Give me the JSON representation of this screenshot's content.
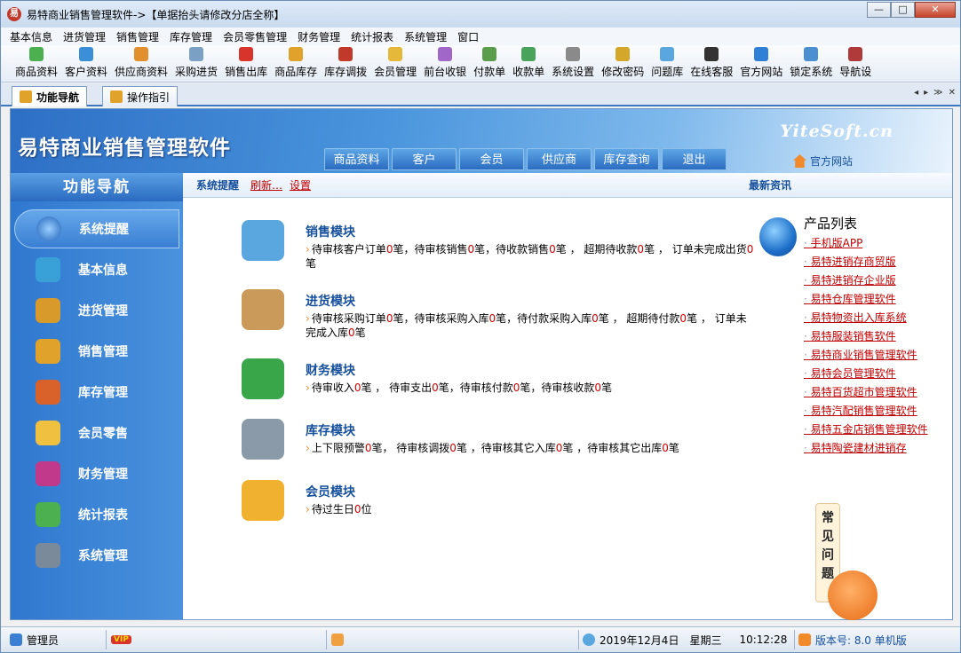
{
  "window": {
    "title": "易特商业销售管理软件->【单据抬头请修改分店全称】",
    "min": "—",
    "max": "□",
    "close": "✕"
  },
  "menu": [
    "基本信息",
    "进货管理",
    "销售管理",
    "库存管理",
    "会员零售管理",
    "财务管理",
    "统计报表",
    "系统管理",
    "窗口"
  ],
  "toolbar": [
    {
      "label": "商品资料",
      "color": "#4caf50"
    },
    {
      "label": "客户资料",
      "color": "#3a8fd6"
    },
    {
      "label": "供应商资料",
      "color": "#e2902d"
    },
    {
      "label": "采购进货",
      "color": "#7aa0c4"
    },
    {
      "label": "销售出库",
      "color": "#d9342b"
    },
    {
      "label": "商品库存",
      "color": "#e0a22a"
    },
    {
      "label": "库存调拨",
      "color": "#c0392b"
    },
    {
      "label": "会员管理",
      "color": "#e6b83a"
    },
    {
      "label": "前台收银",
      "color": "#a066c8"
    },
    {
      "label": "付款单",
      "color": "#5a9e4b"
    },
    {
      "label": "收款单",
      "color": "#4aa35a"
    },
    {
      "label": "系统设置",
      "color": "#8a8a8a"
    },
    {
      "label": "修改密码",
      "color": "#d4a62a"
    },
    {
      "label": "问题库",
      "color": "#5aa7e0"
    },
    {
      "label": "在线客服",
      "color": "#333333"
    },
    {
      "label": "官方网站",
      "color": "#2f7fd6"
    },
    {
      "label": "锁定系统",
      "color": "#4a90d0"
    },
    {
      "label": "导航设",
      "color": "#b03a3a"
    }
  ],
  "tabs": [
    {
      "label": "功能导航"
    },
    {
      "label": "操作指引"
    }
  ],
  "tab_controls": [
    "◂",
    "▸",
    "≫",
    "✕"
  ],
  "banner": {
    "title": "易特商业销售管理软件",
    "brand": "YiteSoft.cn",
    "official": "官方网站"
  },
  "topnav": [
    "商品资料",
    "客户",
    "会员",
    "供应商",
    "库存查询",
    "退出"
  ],
  "sidebar": {
    "head": "功能导航",
    "items": [
      {
        "label": "系统提醒",
        "color": "#1d5fb7"
      },
      {
        "label": "基本信息",
        "color": "#3aa0d8"
      },
      {
        "label": "进货管理",
        "color": "#d89a2a"
      },
      {
        "label": "销售管理",
        "color": "#e0a22a"
      },
      {
        "label": "库存管理",
        "color": "#d9622b"
      },
      {
        "label": "会员零售",
        "color": "#f0c040"
      },
      {
        "label": "财务管理",
        "color": "#c0398b"
      },
      {
        "label": "统计报表",
        "color": "#4caf50"
      },
      {
        "label": "系统管理",
        "color": "#7a8a9a"
      }
    ]
  },
  "content_header": {
    "title": "系统提醒",
    "refresh": "刷新…",
    "settings": "设置",
    "news": "最新资讯"
  },
  "modules": [
    {
      "title": "销售模块",
      "color": "#5aa7e0",
      "parts": [
        "待审核客户订单",
        "0",
        "笔，待审核销售",
        "0",
        "笔，待收款销售",
        "0",
        "笔 ， 超期待收款",
        "0",
        "笔 ， 订单未完成出货",
        "0",
        "笔"
      ]
    },
    {
      "title": "进货模块",
      "color": "#c99a5a",
      "parts": [
        "待审核采购订单",
        "0",
        "笔，待审核采购入库",
        "0",
        "笔，待付款采购入库",
        "0",
        "笔 ， 超期待付款",
        "0",
        "笔 ， 订单未完成入库",
        "0",
        "笔"
      ]
    },
    {
      "title": "财务模块",
      "color": "#3aa64a",
      "parts": [
        "待审收入",
        "0",
        "笔 ， 待审支出",
        "0",
        "笔，待审核付款",
        "0",
        "笔，待审核收款",
        "0",
        "笔"
      ]
    },
    {
      "title": "库存模块",
      "color": "#8a9aa8",
      "parts": [
        "上下限预警",
        "0",
        "笔， 待审核调拨",
        "0",
        "笔 ，待审核其它入库",
        "0",
        "笔 ，待审核其它出库",
        "0",
        "笔"
      ]
    },
    {
      "title": "会员模块",
      "color": "#f0b030",
      "parts": [
        "待过生日",
        "0",
        "位"
      ]
    }
  ],
  "products": {
    "title": "产品列表",
    "items": [
      "手机版APP",
      "易特进销存商贸版",
      "易特进销存企业版",
      "易特仓库管理软件",
      "易特物资出入库系统",
      "易特服装销售软件",
      "易特商业销售管理软件",
      "易特会员管理软件",
      "易特百货超市管理软件",
      "易特汽配销售管理软件",
      "易特五金店销售管理软件",
      "易特陶瓷建材进销存"
    ]
  },
  "faq": "常见问题",
  "status": {
    "user": "管理员",
    "vip": "VIP",
    "date": "2019年12月4日",
    "weekday": "星期三",
    "time": "10:12:28",
    "version": "版本号: 8.0 单机版"
  }
}
